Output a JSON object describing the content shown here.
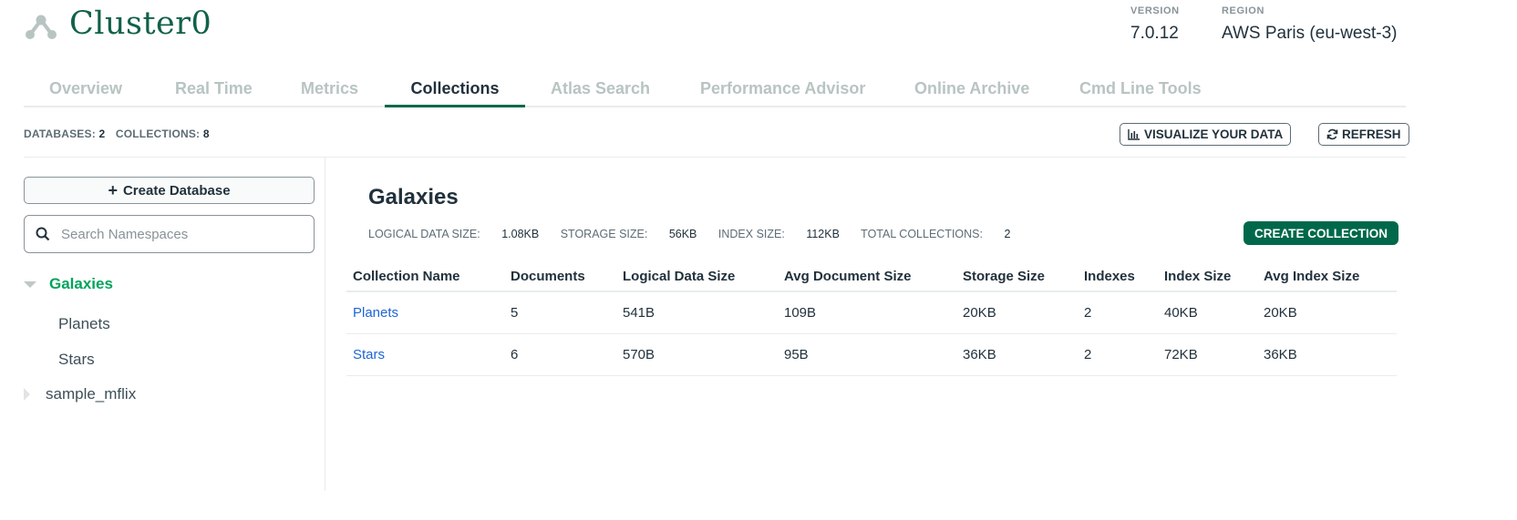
{
  "header": {
    "cluster_name": "Cluster0",
    "version_label": "VERSION",
    "version_value": "7.0.12",
    "region_label": "REGION",
    "region_value": "AWS Paris (eu-west-3)",
    "icon": "cluster-icon"
  },
  "tabs": [
    {
      "label": "Overview",
      "active": false
    },
    {
      "label": "Real Time",
      "active": false
    },
    {
      "label": "Metrics",
      "active": false
    },
    {
      "label": "Collections",
      "active": true
    },
    {
      "label": "Atlas Search",
      "active": false
    },
    {
      "label": "Performance Advisor",
      "active": false
    },
    {
      "label": "Online Archive",
      "active": false
    },
    {
      "label": "Cmd Line Tools",
      "active": false
    }
  ],
  "stats": {
    "databases_label": "DATABASES:",
    "databases_value": "2",
    "collections_label": "COLLECTIONS:",
    "collections_value": "8"
  },
  "toolbar": {
    "visualize_label": "VISUALIZE YOUR DATA",
    "refresh_label": "REFRESH",
    "visualize_icon": "bar-chart-icon",
    "refresh_icon": "refresh-icon"
  },
  "sidebar": {
    "create_database_label": "Create Database",
    "search_placeholder": "Search Namespaces",
    "databases": [
      {
        "name": "Galaxies",
        "expanded": true,
        "collections": [
          "Planets",
          "Stars"
        ]
      },
      {
        "name": "sample_mflix",
        "expanded": false,
        "collections": []
      }
    ]
  },
  "main": {
    "db_title": "Galaxies",
    "logical_size_label": "LOGICAL DATA SIZE:",
    "logical_size_value": "1.08KB",
    "storage_size_label": "STORAGE SIZE:",
    "storage_size_value": "56KB",
    "index_size_label": "INDEX SIZE:",
    "index_size_value": "112KB",
    "total_collections_label": "TOTAL COLLECTIONS:",
    "total_collections_value": "2",
    "create_collection_label": "CREATE COLLECTION",
    "columns": [
      "Collection Name",
      "Documents",
      "Logical Data Size",
      "Avg Document Size",
      "Storage Size",
      "Indexes",
      "Index Size",
      "Avg Index Size"
    ],
    "rows": [
      [
        "Planets",
        "5",
        "541B",
        "109B",
        "20KB",
        "2",
        "40KB",
        "20KB"
      ],
      [
        "Stars",
        "6",
        "570B",
        "95B",
        "36KB",
        "2",
        "72KB",
        "36KB"
      ]
    ]
  },
  "colors": {
    "brand_green": "#00684a",
    "title_green": "#116149",
    "active_db_green": "#00a35c",
    "link_blue": "#1e65d6"
  }
}
